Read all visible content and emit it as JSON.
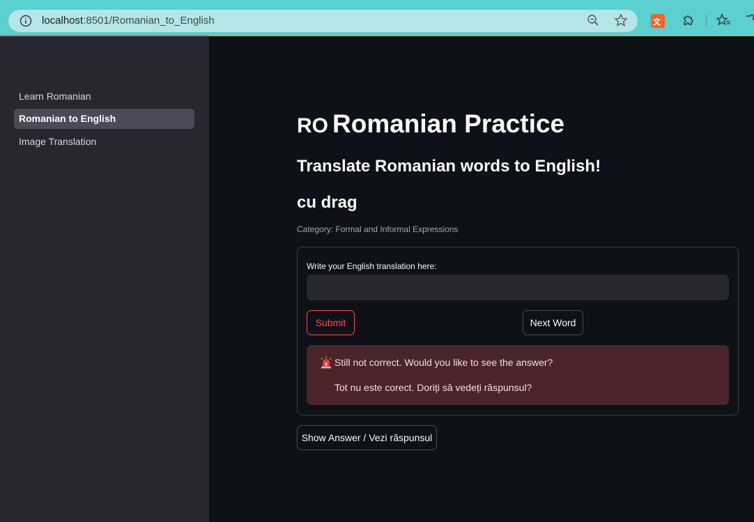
{
  "browser": {
    "url_host": "localhost",
    "url_rest": ":8501/Romanian_to_English"
  },
  "sidebar": {
    "items": [
      {
        "label": "Learn Romanian",
        "active": false
      },
      {
        "label": "Romanian to English",
        "active": true
      },
      {
        "label": "Image Translation",
        "active": false
      }
    ]
  },
  "main": {
    "title_flag": "RO",
    "title": "Romanian Practice",
    "subtitle": "Translate Romanian words to English!",
    "word": "cu drag",
    "category": "Category: Formal and Informal Expressions",
    "form": {
      "input_label": "Write your English translation here:",
      "input_value": "",
      "submit_label": "Submit",
      "next_label": "Next Word"
    },
    "alert": {
      "line1": "Still not correct. Would you like to see the answer?",
      "line2": "Tot nu este corect. Doriți să vedeți răspunsul?"
    },
    "show_answer_label": "Show Answer / Vezi răspunsul"
  },
  "colors": {
    "accent": "#ff4b4b",
    "sidebar_bg": "#262730",
    "main_bg": "#0e1117",
    "alert_bg": "#4b2429",
    "browser_bar": "#5ccfcf"
  }
}
